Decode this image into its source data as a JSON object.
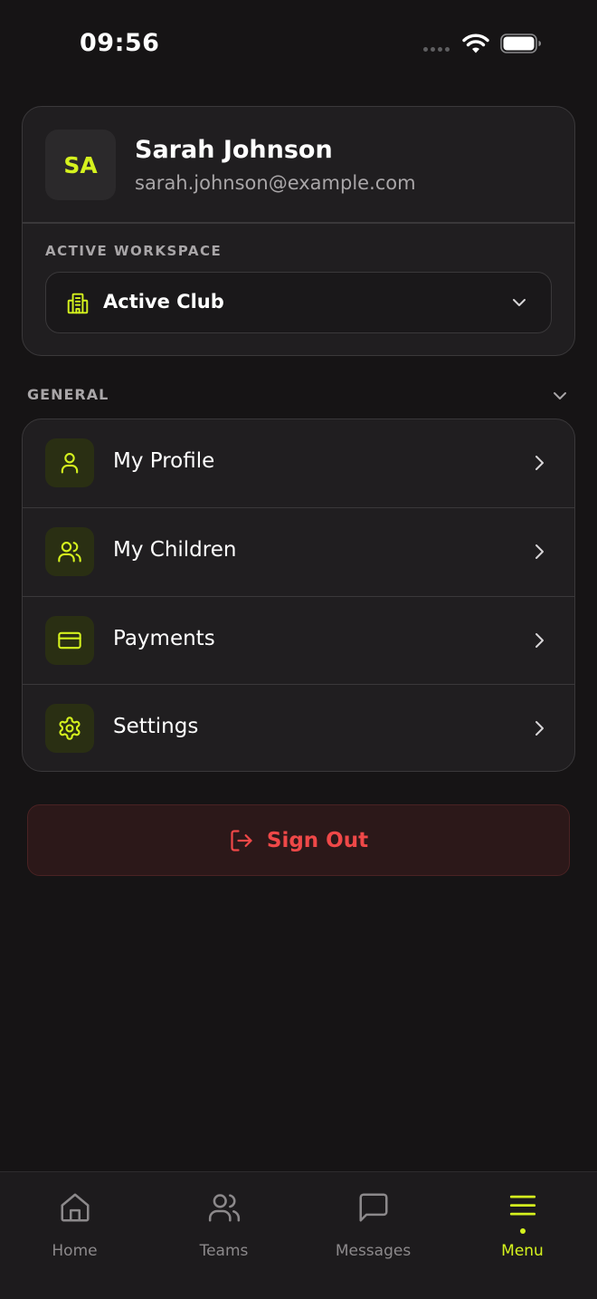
{
  "status_bar": {
    "time": "09:56",
    "icons": [
      "signal-dots-icon",
      "wifi-icon",
      "battery-icon"
    ]
  },
  "profile": {
    "initials": "SA",
    "name": "Sarah Johnson",
    "email": "sarah.johnson@example.com"
  },
  "workspace": {
    "label": "ACTIVE WORKSPACE",
    "selected": "Active Club",
    "icon": "building-icon"
  },
  "general": {
    "label": "GENERAL",
    "items": [
      {
        "label": "My Profile",
        "icon": "user-icon"
      },
      {
        "label": "My Children",
        "icon": "users-icon"
      },
      {
        "label": "Payments",
        "icon": "credit-card-icon"
      },
      {
        "label": "Settings",
        "icon": "gear-icon"
      }
    ]
  },
  "sign_out": {
    "label": "Sign Out",
    "icon": "logout-icon"
  },
  "bottom_nav": {
    "items": [
      {
        "label": "Home",
        "icon": "home-icon",
        "active": false
      },
      {
        "label": "Teams",
        "icon": "users-icon",
        "active": false
      },
      {
        "label": "Messages",
        "icon": "message-icon",
        "active": false
      },
      {
        "label": "Menu",
        "icon": "menu-icon",
        "active": true
      }
    ]
  },
  "colors": {
    "background": "#161415",
    "card": "#201e20",
    "accent": "#d5f21e",
    "danger": "#ef4848",
    "muted_text": "#a9a6a8"
  }
}
